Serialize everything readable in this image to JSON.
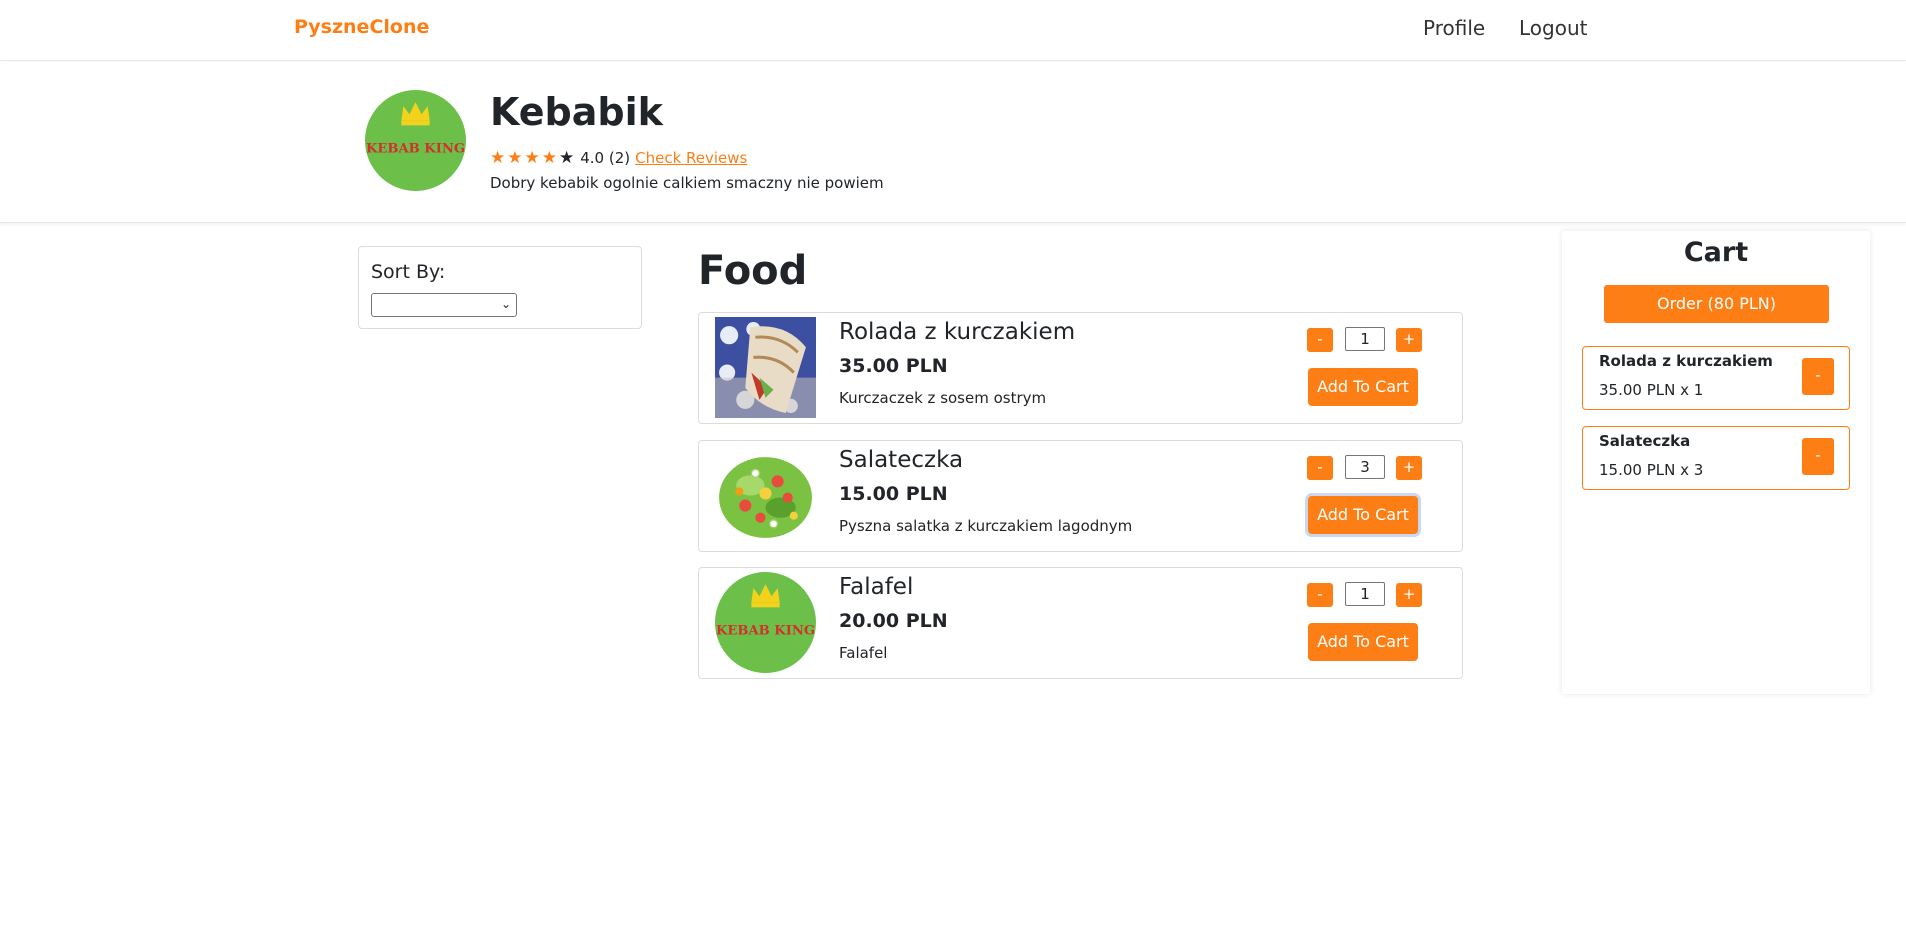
{
  "navbar": {
    "brand": "PyszneClone",
    "links": [
      {
        "label": "Profile"
      },
      {
        "label": "Logout"
      }
    ]
  },
  "restaurant": {
    "name": "Kebabik",
    "logo_text": "KEBAB KING",
    "rating_stars": 4,
    "rating_max": 5,
    "rating_label": "4.0 (2)",
    "reviews_link": "Check Reviews",
    "description": "Dobry kebabik ogolnie calkiem smaczny nie powiem"
  },
  "sort": {
    "label": "Sort By:",
    "selected": ""
  },
  "food": {
    "title": "Food",
    "items": [
      {
        "name": "Rolada z kurczakiem",
        "price": "35.00 PLN",
        "description": "Kurczaczek z sosem ostrym",
        "quantity": "1",
        "minus": "-",
        "plus": "+",
        "add_label": "Add To Cart",
        "image": "chicken-wrap"
      },
      {
        "name": "Salateczka",
        "price": "15.00 PLN",
        "description": "Pyszna salatka z kurczakiem lagodnym",
        "quantity": "3",
        "minus": "-",
        "plus": "+",
        "add_label": "Add To Cart",
        "image": "salad"
      },
      {
        "name": "Falafel",
        "price": "20.00 PLN",
        "description": "Falafel",
        "quantity": "1",
        "minus": "-",
        "plus": "+",
        "add_label": "Add To Cart",
        "image": "kebab-king-logo"
      }
    ]
  },
  "cart": {
    "title": "Cart",
    "order_label": "Order (80 PLN)",
    "items": [
      {
        "name": "Rolada z kurczakiem",
        "detail": "35.00 PLN x 1",
        "remove": "-"
      },
      {
        "name": "Salateczka",
        "detail": "15.00 PLN x 3",
        "remove": "-"
      }
    ]
  },
  "colors": {
    "accent": "#fd7e14",
    "logo_green": "#6cc04a",
    "logo_red": "#d0312d",
    "logo_crown": "#f2d21b"
  }
}
